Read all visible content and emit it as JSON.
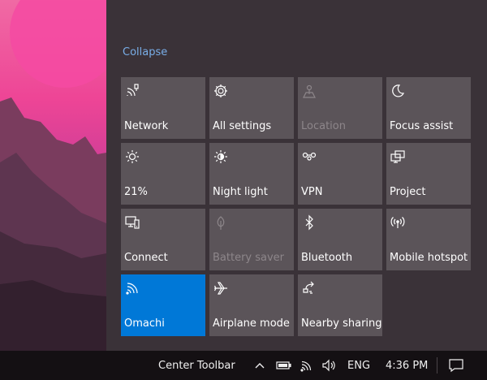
{
  "action_center": {
    "collapse_label": "Collapse",
    "tiles": [
      {
        "label": "Network",
        "icon": "network-icon",
        "state": "normal"
      },
      {
        "label": "All settings",
        "icon": "gear-icon",
        "state": "normal"
      },
      {
        "label": "Location",
        "icon": "location-icon",
        "state": "disabled"
      },
      {
        "label": "Focus assist",
        "icon": "moon-icon",
        "state": "normal"
      },
      {
        "label": "21%",
        "icon": "brightness-icon",
        "state": "normal"
      },
      {
        "label": "Night light",
        "icon": "night-light-icon",
        "state": "normal"
      },
      {
        "label": "VPN",
        "icon": "vpn-icon",
        "state": "normal"
      },
      {
        "label": "Project",
        "icon": "project-icon",
        "state": "normal"
      },
      {
        "label": "Connect",
        "icon": "connect-icon",
        "state": "normal"
      },
      {
        "label": "Battery saver",
        "icon": "battery-saver-icon",
        "state": "disabled"
      },
      {
        "label": "Bluetooth",
        "icon": "bluetooth-icon",
        "state": "normal"
      },
      {
        "label": "Mobile hotspot",
        "icon": "mobile-hotspot-icon",
        "state": "normal"
      },
      {
        "label": "Omachi",
        "icon": "wifi-icon",
        "state": "on"
      },
      {
        "label": "Airplane mode",
        "icon": "airplane-icon",
        "state": "normal"
      },
      {
        "label": "Nearby sharing",
        "icon": "nearby-sharing-icon",
        "state": "normal"
      }
    ]
  },
  "taskbar": {
    "toolbar_label": "Center Toolbar",
    "language": "ENG",
    "time": "4:36 PM",
    "tray_icons": [
      "chevron-up-icon",
      "battery-icon",
      "wifi-icon",
      "volume-icon"
    ],
    "notification_icon": "notification-icon"
  },
  "colors": {
    "accent": "#0078d7",
    "tile": "#5b5459",
    "panel": "#3a3238",
    "link": "#79aee8"
  }
}
